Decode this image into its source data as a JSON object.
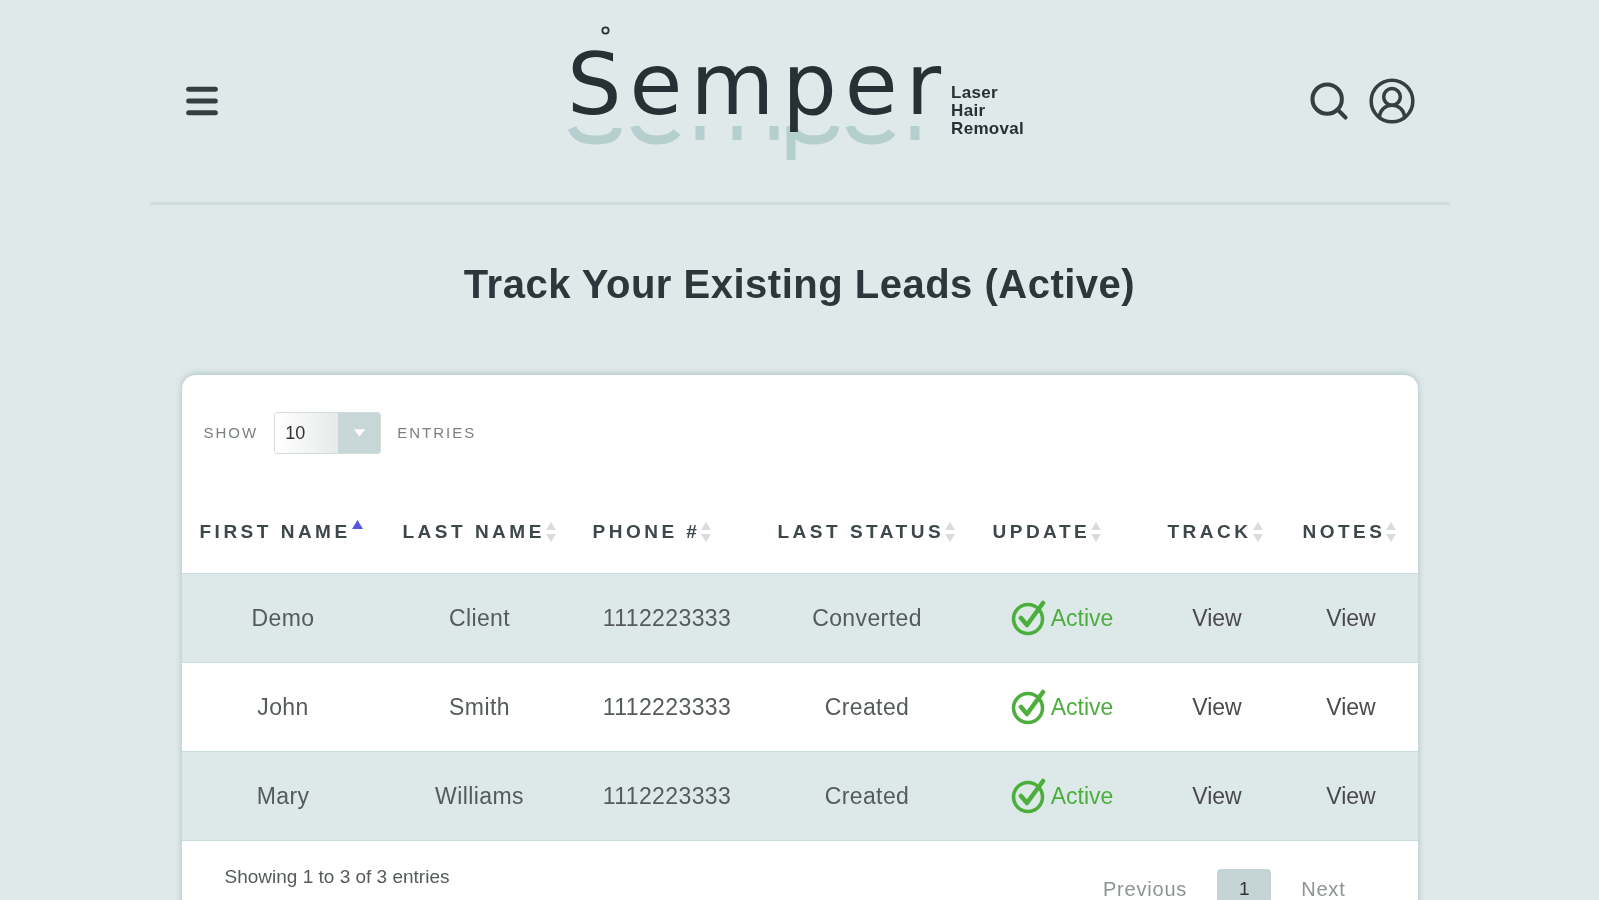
{
  "header": {
    "logo": {
      "wordmark": "Semper",
      "tagline": "Laser Hair Removal"
    }
  },
  "title": "Track Your Existing Leads (Active)",
  "table_controls": {
    "show_label": "SHOW",
    "page_size": "10",
    "entries_label": "ENTRIES"
  },
  "table": {
    "columns": [
      {
        "label": "FIRST NAME",
        "sorted": true
      },
      {
        "label": "LAST NAME",
        "sorted": false
      },
      {
        "label": "PHONE #",
        "sorted": false
      },
      {
        "label": "LAST STATUS",
        "sorted": false
      },
      {
        "label": "UPDATE",
        "sorted": false
      },
      {
        "label": "TRACK",
        "sorted": false
      },
      {
        "label": "NOTES",
        "sorted": false
      }
    ],
    "rows": [
      {
        "first_name": "Demo",
        "last_name": "Client",
        "phone": "1112223333",
        "last_status": "Converted",
        "update": {
          "label": "Active",
          "active": true
        },
        "track": "View",
        "notes": "View"
      },
      {
        "first_name": "John",
        "last_name": "Smith",
        "phone": "1112223333",
        "last_status": "Created",
        "update": {
          "label": "Active",
          "active": true
        },
        "track": "View",
        "notes": "View"
      },
      {
        "first_name": "Mary",
        "last_name": "Williams",
        "phone": "1112223333",
        "last_status": "Created",
        "update": {
          "label": "Active",
          "active": true
        },
        "track": "View",
        "notes": "View"
      }
    ]
  },
  "footer": {
    "info": "Showing 1 to 3 of 3 entries",
    "previous": {
      "label": "Previous",
      "disabled": true
    },
    "pages": [
      {
        "label": "1",
        "selected": true
      }
    ],
    "next": {
      "label": "Next",
      "disabled": true
    }
  }
}
